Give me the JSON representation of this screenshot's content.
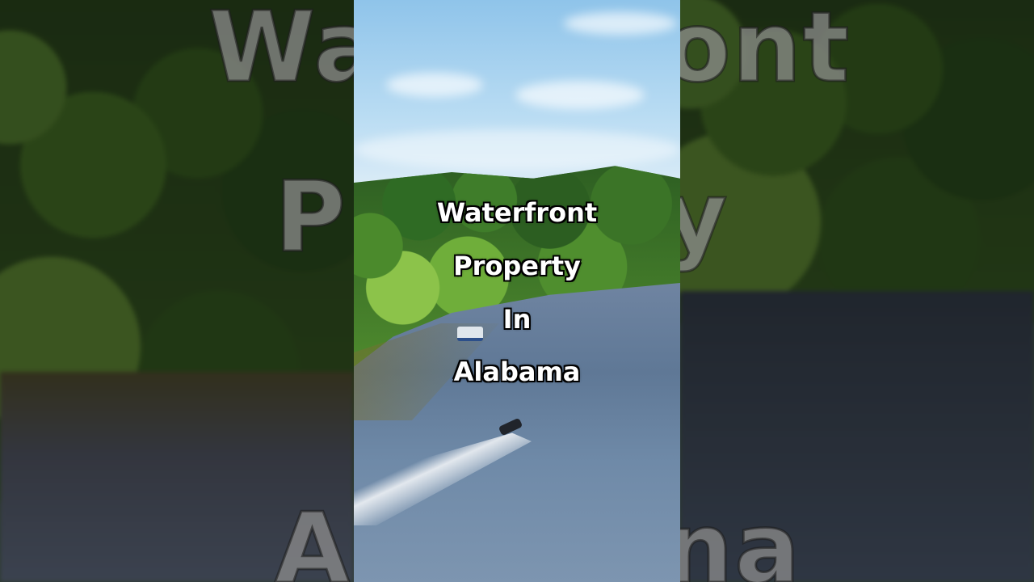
{
  "caption": {
    "line1": "Waterfront",
    "line2": "Property",
    "line3": "In",
    "line4": "Alabama"
  },
  "background_words": {
    "left_top": "Wa",
    "right_top": "ont",
    "left_mid": "P",
    "right_mid": "y",
    "left_bottom": "A",
    "right_bottom": "na"
  },
  "colors": {
    "text": "#ffffff",
    "text_outline": "#000000",
    "sky": "#8fc4ea",
    "water": "#6f84a1",
    "foliage": "#4f8b2e"
  }
}
